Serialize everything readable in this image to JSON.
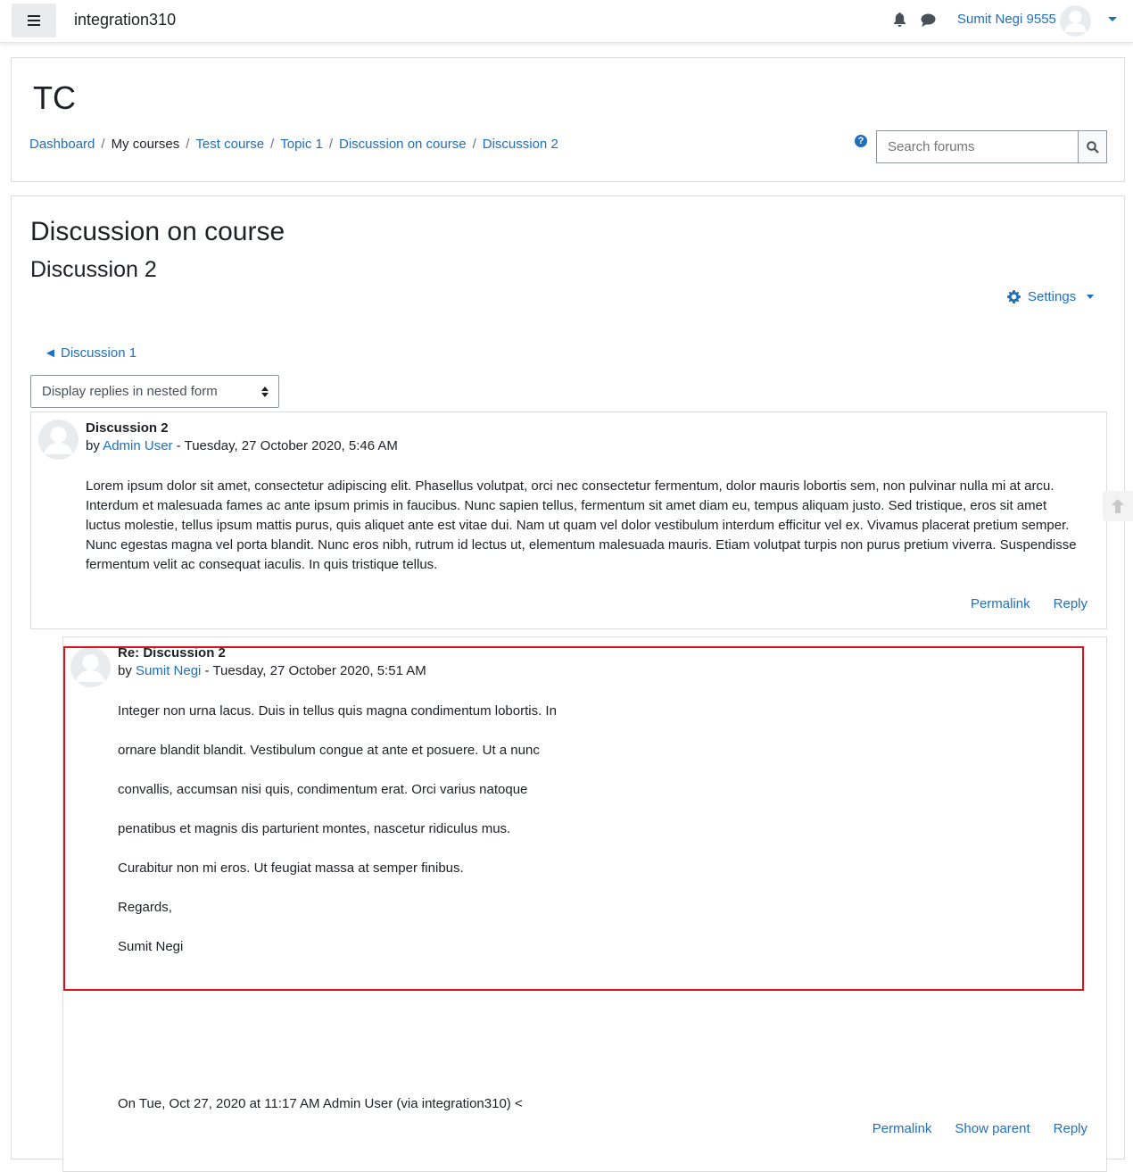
{
  "navbar": {
    "site_name": "integration310",
    "menu_icon": "hamburger-icon",
    "notifications_icon": "bell-icon",
    "messages_icon": "chat-icon",
    "user_name": "Sumit Negi 9555"
  },
  "header": {
    "course_short_name": "TC",
    "breadcrumb": {
      "dashboard": "Dashboard",
      "my_courses": "My courses",
      "test_course": "Test course",
      "topic": "Topic 1",
      "forum": "Discussion on course",
      "discussion": "Discussion 2"
    },
    "search": {
      "placeholder": "Search forums"
    }
  },
  "main": {
    "forum_name": "Discussion on course",
    "discussion_name": "Discussion 2",
    "settings_label": "Settings",
    "prev_discussion": "◄ Discussion 1",
    "display_mode": "Display replies in nested form"
  },
  "posts": [
    {
      "subject": "Discussion 2",
      "by": "by",
      "author": "Admin User",
      "date": "- Tuesday, 27 October 2020, 5:46 AM",
      "body": "Lorem ipsum dolor sit amet, consectetur adipiscing elit. Phasellus volutpat, orci nec consectetur fermentum, dolor mauris lobortis sem, non pulvinar nulla mi at arcu. Interdum et malesuada fames ac ante ipsum primis in faucibus. Nunc sapien tellus, fermentum sit amet diam eu, tempus aliquam justo. Sed tristique, eros sit amet luctus molestie, tellus ipsum mattis purus, quis aliquet ante est vitae dui. Nam ut quam vel dolor vestibulum interdum efficitur vel ex. Vivamus placerat pretium semper. Nunc egestas magna vel porta blandit. Nunc eros nibh, rutrum id lectus ut, elementum malesuada mauris. Etiam volutpat turpis non purus pretium viverra. Suspendisse fermentum velit ac consequat iaculis. In quis tristique tellus.",
      "permalink": "Permalink",
      "reply": "Reply"
    },
    {
      "subject": "Re: Discussion 2",
      "by": "by",
      "author": "Sumit Negi",
      "date": "- Tuesday, 27 October 2020, 5:51 AM",
      "paragraphs": [
        "Integer non urna lacus. Duis in tellus quis magna condimentum lobortis. In",
        "ornare blandit blandit. Vestibulum congue at ante et posuere. Ut a nunc",
        "convallis, accumsan nisi quis, condimentum erat. Orci varius natoque",
        "penatibus et magnis dis parturient montes, nascetur ridiculus mus.",
        "Curabitur non mi eros. Ut feugiat massa at semper finibus.",
        "Regards,",
        "Sumit Negi"
      ],
      "quoted_header": "On Tue, Oct 27, 2020 at 11:17 AM Admin User (via integration310) <",
      "permalink": "Permalink",
      "show_parent": "Show parent",
      "reply": "Reply"
    }
  ],
  "colors": {
    "link": "#1f6fbf",
    "highlight_box": "#e0101a"
  }
}
